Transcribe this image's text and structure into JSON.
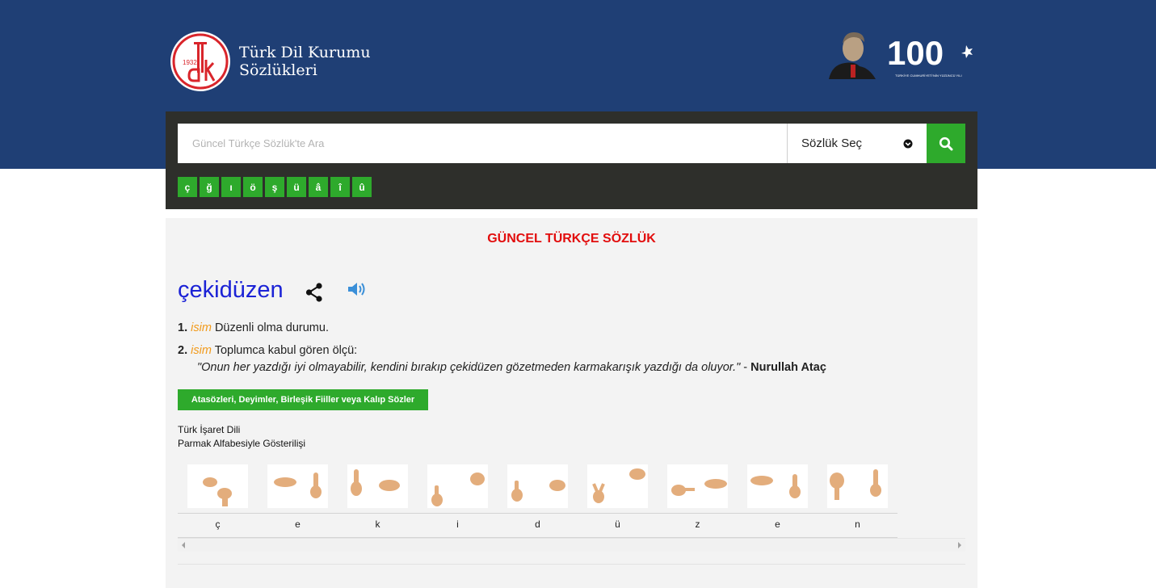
{
  "header": {
    "logo_year": "1932",
    "logo_line1": "Türk Dil Kurumu",
    "logo_line2": "Sözlükleri",
    "badge_text": "100",
    "badge_caption": "TÜRKİYE CUMHURİYETİ'NİN YÜZÜNCÜ YILI"
  },
  "search": {
    "placeholder": "Güncel Türkçe Sözlük'te Ara",
    "value": "",
    "dictionary_select": "Sözlük Seç",
    "special_chars": [
      "ç",
      "ğ",
      "ı",
      "ö",
      "ş",
      "ü",
      "â",
      "î",
      "û"
    ]
  },
  "entry": {
    "section_title": "GÜNCEL TÜRKÇE SÖZLÜK",
    "word": "çekidüzen",
    "meanings": [
      {
        "num": "1.",
        "pos": "isim",
        "text": "Düzenli olma durumu."
      },
      {
        "num": "2.",
        "pos": "isim",
        "text": "Toplumca kabul gören ölçü:"
      }
    ],
    "example": {
      "quote": "\"Onun her yazdığı iyi olmayabilir, kendini bırakıp çekidüzen gözetmeden karmakarışık yazdığı da oluyor.\"",
      "separator": " - ",
      "author": "Nurullah Ataç"
    },
    "idioms_button": "Atasözleri, Deyimler, Birleşik Fiiller veya Kalıp Sözler"
  },
  "sign_language": {
    "title_line1": "Türk İşaret Dili",
    "title_line2": "Parmak Alfabesiyle Gösterilişi",
    "letters": [
      "ç",
      "e",
      "k",
      "i",
      "d",
      "ü",
      "z",
      "e",
      "n"
    ]
  },
  "colors": {
    "header_bg": "#1f3f75",
    "panel_bg": "#2e2f2b",
    "accent_green": "#2eaa2c",
    "title_red": "#e20d0d",
    "word_blue": "#1b22d6",
    "pos_orange": "#f29a1a"
  },
  "icons": {
    "search": "magnifier-icon",
    "share": "share-icon",
    "audio": "speaker-icon",
    "select": "chevron-down-icon"
  }
}
